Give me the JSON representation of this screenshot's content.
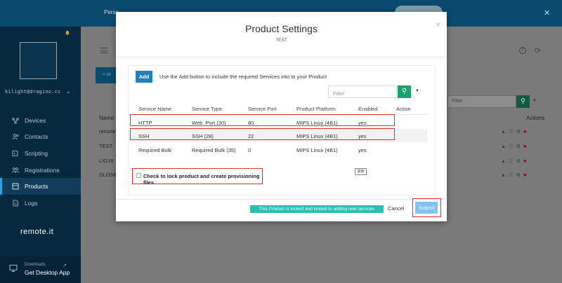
{
  "banner": {
    "text": "Perso",
    "close_icon": "close-icon"
  },
  "sidebar": {
    "user_email": "kilight@dragino.cc",
    "nav": [
      {
        "label": "Devices",
        "icon": "devices-icon"
      },
      {
        "label": "Contacts",
        "icon": "contacts-icon"
      },
      {
        "label": "Scripting",
        "icon": "scripting-icon"
      },
      {
        "label": "Registrations",
        "icon": "registrations-icon"
      },
      {
        "label": "Products",
        "icon": "products-icon",
        "active": true
      },
      {
        "label": "Logs",
        "icon": "logs-icon"
      }
    ],
    "brand": "remote.it",
    "downloads": {
      "small": "Downloads",
      "big": "Get Desktop App"
    }
  },
  "background": {
    "create_label": "+ cr",
    "name_header": "Name",
    "rows": [
      "remote_",
      "TEST",
      "LIG16",
      "DLOS8"
    ],
    "filter_placeholder": "Filter",
    "actions_header": "Actions"
  },
  "modal": {
    "title": "Product Settings",
    "subtitle": "TEST",
    "add_label": "Add",
    "add_hint": "Use the Add button to include the required Services into to your Product",
    "filter_placeholder": "Filter",
    "columns": {
      "service_name": "Service Name",
      "service_type": "Service Type",
      "service_port": "Service Port",
      "product_platform": "Product Platform",
      "enabled": "Enabled",
      "action": "Action"
    },
    "rows": [
      {
        "service_name": "HTTP",
        "service_type": "Web_Port (30)",
        "service_port": "80",
        "product_platform": "MIPS Linux (4B1)",
        "enabled": "yes"
      },
      {
        "service_name": "SSH",
        "service_type": "SSH (28)",
        "service_port": "22",
        "product_platform": "MIPS Linux (4B1)",
        "enabled": "yes"
      },
      {
        "service_name": "Required Bulk",
        "service_type": "Required Bulk (35)",
        "service_port": "0",
        "product_platform": "MIPS Linux (4B1)",
        "enabled": "yes"
      }
    ],
    "lock_label": "Check to lock product and create provisioning files",
    "keyboard_hint": "其他",
    "locked_badge": "This Product is locked and limited to adding new services",
    "cancel_label": "Cancel",
    "submit_label": "Submit"
  },
  "colors": {
    "accent": "#1f7fc1",
    "filter_green": "#1ca16c",
    "badge_teal": "#2bbfb2",
    "highlight_red": "#d9302c",
    "submit_light_blue": "#83c3ee"
  }
}
